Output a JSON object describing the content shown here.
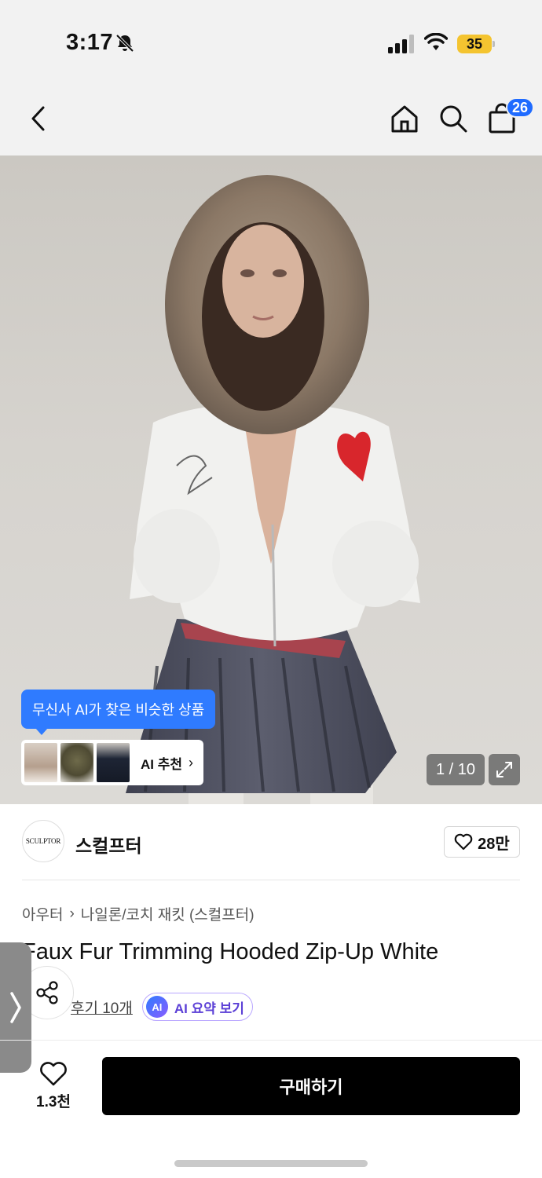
{
  "status_bar": {
    "time": "3:17",
    "battery": "35"
  },
  "header": {
    "cart_count": "26"
  },
  "gallery": {
    "ai_tooltip": "무신사 AI가 찾은 비슷한 상품",
    "ai_reco_label": "AI 추천",
    "page_counter": "1 / 10"
  },
  "brand": {
    "logo_text": "SCULPTOR",
    "name": "스컬프터",
    "likes": "28만"
  },
  "product": {
    "breadcrumb": [
      "아우터",
      "나일론/코치 재킷 (스컬프터)"
    ],
    "title": "Faux Fur Trimming Hooded Zip-Up White",
    "reviews": "후기 10개",
    "ai_badge": "AI",
    "ai_summary": "AI 요약 보기"
  },
  "bottom_bar": {
    "wish_count": "1.3천",
    "buy_label": "구매하기"
  },
  "colors": {
    "accent_blue": "#2f7bff",
    "cart_badge": "#1f6bff",
    "buy_button": "#000000"
  }
}
